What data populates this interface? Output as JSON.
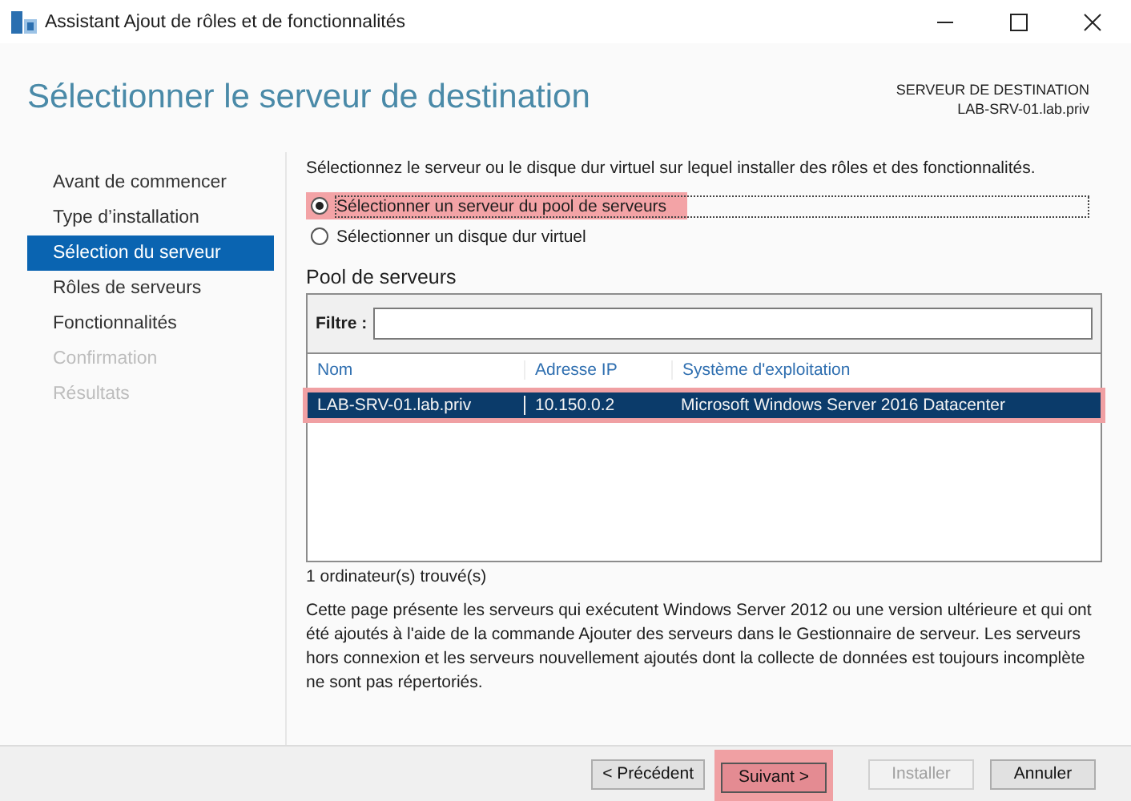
{
  "window": {
    "title": "Assistant Ajout de rôles et de fonctionnalités"
  },
  "header": {
    "title": "Sélectionner le serveur de destination",
    "destination_label": "SERVEUR DE DESTINATION",
    "destination_server": "LAB-SRV-01.lab.priv"
  },
  "steps": [
    {
      "label": "Avant de commencer",
      "selected": false,
      "disabled": false
    },
    {
      "label": "Type d’installation",
      "selected": false,
      "disabled": false
    },
    {
      "label": "Sélection du serveur",
      "selected": true,
      "disabled": false
    },
    {
      "label": "Rôles de serveurs",
      "selected": false,
      "disabled": false
    },
    {
      "label": "Fonctionnalités",
      "selected": false,
      "disabled": false
    },
    {
      "label": "Confirmation",
      "selected": false,
      "disabled": true
    },
    {
      "label": "Résultats",
      "selected": false,
      "disabled": true
    }
  ],
  "instruction": "Sélectionnez le serveur ou le disque dur virtuel sur lequel installer des rôles et des fonctionnalités.",
  "options": [
    {
      "label": "Sélectionner un serveur du pool de serveurs",
      "selected": true,
      "highlighted": true
    },
    {
      "label": "Sélectionner un disque dur virtuel",
      "selected": false,
      "highlighted": false
    }
  ],
  "pool": {
    "title": "Pool de serveurs",
    "filter_label": "Filtre :",
    "columns": [
      "Nom",
      "Adresse IP",
      "Système d'exploitation"
    ],
    "rows": [
      {
        "cells": [
          "LAB-SRV-01.lab.priv",
          "10.150.0.2",
          "Microsoft Windows Server 2016 Datacenter"
        ],
        "selected": true,
        "highlighted": true
      }
    ],
    "count": "1 ordinateur(s) trouvé(s)"
  },
  "description": "Cette page présente les serveurs qui exécutent Windows Server 2012 ou une version ultérieure et qui ont été ajoutés à l'aide de la commande Ajouter des serveurs dans le Gestionnaire de serveur. Les serveurs hors connexion et les serveurs nouvellement ajoutés dont la collecte de données est toujours incomplète ne sont pas répertoriés.",
  "buttons": [
    {
      "label": "< Précédent",
      "disabled": false,
      "highlighted": false
    },
    {
      "label": "Suivant >",
      "disabled": false,
      "highlighted": true
    },
    {
      "label": "Installer",
      "disabled": true,
      "highlighted": false
    },
    {
      "label": "Annuler",
      "disabled": false,
      "highlighted": false
    }
  ]
}
